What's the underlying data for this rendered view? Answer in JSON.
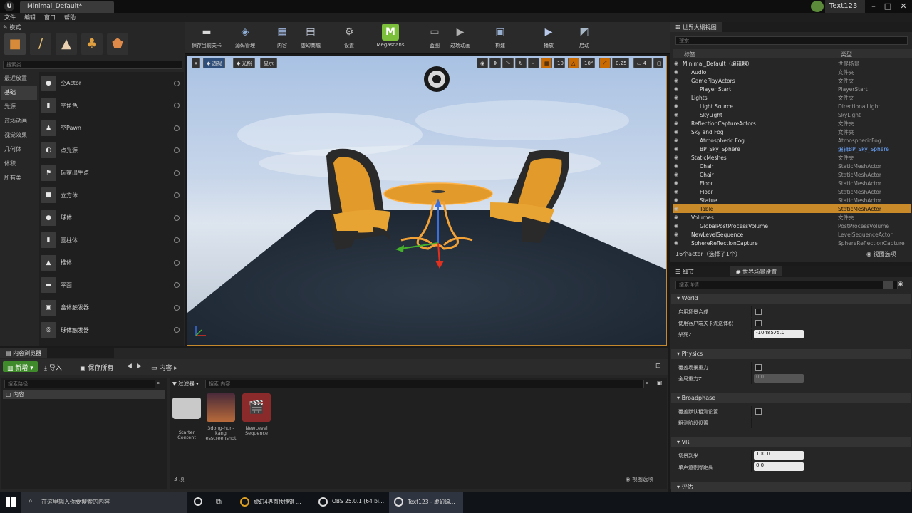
{
  "window": {
    "tab_title": "Minimal_Default*",
    "project_name": "Text123"
  },
  "menu": [
    "文件",
    "编辑",
    "窗口",
    "帮助"
  ],
  "modes": {
    "header": "模式",
    "search_placeholder": "搜索类",
    "categories": [
      "最近放置",
      "基础",
      "光源",
      "过场动画",
      "视觉效果",
      "几何体",
      "体积",
      "所有类"
    ],
    "active_category_index": 1,
    "items": [
      "空Actor",
      "空角色",
      "空Pawn",
      "点光源",
      "玩家出生点",
      "立方体",
      "球体",
      "圆柱体",
      "椎体",
      "平面",
      "盒体触发器",
      "球体触发器"
    ]
  },
  "toolbar": [
    {
      "label": "保存当前关卡",
      "icon": "save-icon",
      "color": "#d9d9d9"
    },
    {
      "label": "源码管理",
      "icon": "source-control-icon",
      "color": "#8fb0d8"
    },
    {
      "label": "内容",
      "icon": "content-icon",
      "color": "#a0b8e0"
    },
    {
      "label": "虚幻商城",
      "icon": "marketplace-icon",
      "color": "#c0c8d8"
    },
    {
      "label": "设置",
      "icon": "settings-icon",
      "color": "#b0b0b0"
    },
    {
      "label": "Megascans",
      "icon": "megascans-icon",
      "color": "#7cbf3a"
    },
    {
      "label": "蓝图",
      "icon": "blueprint-icon",
      "color": "#a0a0a0"
    },
    {
      "label": "过场动画",
      "icon": "cinematics-icon",
      "color": "#b0b0b0"
    },
    {
      "label": "构建",
      "icon": "build-icon",
      "color": "#9ab0d0"
    },
    {
      "label": "播放",
      "icon": "play-icon",
      "color": "#b8c8e8"
    },
    {
      "label": "启动",
      "icon": "launch-icon",
      "color": "#a8b8c8"
    }
  ],
  "viewport": {
    "buttons": [
      "透视",
      "光照",
      "显示"
    ],
    "grid_snap": "10",
    "rotation_snap": "10°",
    "scale_snap": "0.25",
    "camera_speed": "4"
  },
  "outliner": {
    "tab_title": "世界大纲视图",
    "search_placeholder": "搜索",
    "col_label": "标签",
    "col_type": "类型",
    "rows": [
      {
        "name": "Minimal_Default（编辑器）",
        "type": "世界场景",
        "indent": 0
      },
      {
        "name": "Audio",
        "type": "文件夹",
        "indent": 1
      },
      {
        "name": "GamePlayActors",
        "type": "文件夹",
        "indent": 1
      },
      {
        "name": "Player Start",
        "type": "PlayerStart",
        "indent": 2
      },
      {
        "name": "Lights",
        "type": "文件夹",
        "indent": 1
      },
      {
        "name": "Light Source",
        "type": "DirectionalLight",
        "indent": 2
      },
      {
        "name": "SkyLight",
        "type": "SkyLight",
        "indent": 2
      },
      {
        "name": "ReflectionCaptureActors",
        "type": "文件夹",
        "indent": 1
      },
      {
        "name": "Sky and Fog",
        "type": "文件夹",
        "indent": 1
      },
      {
        "name": "Atmospheric Fog",
        "type": "AtmosphericFog",
        "indent": 2
      },
      {
        "name": "BP_Sky_Sphere",
        "type": "编辑BP_Sky_Sphere",
        "indent": 2,
        "link": true
      },
      {
        "name": "StaticMeshes",
        "type": "文件夹",
        "indent": 1
      },
      {
        "name": "Chair",
        "type": "StaticMeshActor",
        "indent": 2
      },
      {
        "name": "Chair",
        "type": "StaticMeshActor",
        "indent": 2
      },
      {
        "name": "Floor",
        "type": "StaticMeshActor",
        "indent": 2
      },
      {
        "name": "Floor",
        "type": "StaticMeshActor",
        "indent": 2
      },
      {
        "name": "Statue",
        "type": "StaticMeshActor",
        "indent": 2
      },
      {
        "name": "Table",
        "type": "StaticMeshActor",
        "indent": 2,
        "selected": true
      },
      {
        "name": "Volumes",
        "type": "文件夹",
        "indent": 1
      },
      {
        "name": "GlobalPostProcessVolume",
        "type": "PostProcessVolume",
        "indent": 2
      },
      {
        "name": "NewLevelSequence",
        "type": "LevelSequenceActor",
        "indent": 1
      },
      {
        "name": "SphereReflectionCapture",
        "type": "SphereReflectionCapture",
        "indent": 1
      }
    ],
    "footer_count": "16个actor（选择了1个）",
    "view_options": "视图选项"
  },
  "details": {
    "tabs": [
      "细节",
      "世界场景设置"
    ],
    "search_placeholder": "搜索详情",
    "sections": [
      {
        "title": "World",
        "props": [
          {
            "label": "启用场景合成",
            "kind": "check"
          },
          {
            "label": "使用客户端关卡流送体积",
            "kind": "check"
          },
          {
            "label": "杀死Z",
            "kind": "num",
            "value": "-1048575.0"
          }
        ]
      },
      {
        "title": "Physics",
        "props": [
          {
            "label": "覆盖场景重力",
            "kind": "check"
          },
          {
            "label": "全局重力Z",
            "kind": "num",
            "value": "0.0",
            "dim": true
          }
        ]
      },
      {
        "title": "Broadphase",
        "props": [
          {
            "label": "覆盖默认粗测设置",
            "kind": "check"
          },
          {
            "label": "粗测阶段设置",
            "kind": "none"
          }
        ]
      },
      {
        "title": "VR",
        "props": [
          {
            "label": "场景到米",
            "kind": "num",
            "value": "100.0"
          },
          {
            "label": "单声道剔除距离",
            "kind": "num",
            "value": "0.0"
          }
        ]
      }
    ],
    "footer_section": "评估"
  },
  "content_browser": {
    "tab_title": "内容浏览器",
    "new_btn": "新增",
    "import_btn": "导入",
    "save_all_btn": "保存所有",
    "path_label": "内容",
    "path_search_placeholder": "搜索路径",
    "tree_root": "内容",
    "filter_label": "过滤器",
    "asset_search_placeholder": "搜索 内容",
    "assets": [
      {
        "name": "Starter Content",
        "kind": "folder"
      },
      {
        "name": "3dong-hun-kang esscreenshot",
        "kind": "image"
      },
      {
        "name": "NewLevel Sequence",
        "kind": "sequence"
      }
    ],
    "item_count": "3 项",
    "view_options": "视图选项"
  },
  "taskbar": {
    "search_placeholder": "在这里输入你要搜索的内容",
    "apps": [
      {
        "label": "虚幻4界面快捷键 ...",
        "icon": "chrome-icon"
      },
      {
        "label": "OBS 25.0.1 (64 bi...",
        "icon": "obs-icon"
      },
      {
        "label": "Text123 - 虚幻编...",
        "icon": "unreal-icon"
      }
    ]
  },
  "colors": {
    "selection": "#c98a2a",
    "accent_orange": "#e39a2a",
    "megascans_green": "#7cbf3a"
  }
}
